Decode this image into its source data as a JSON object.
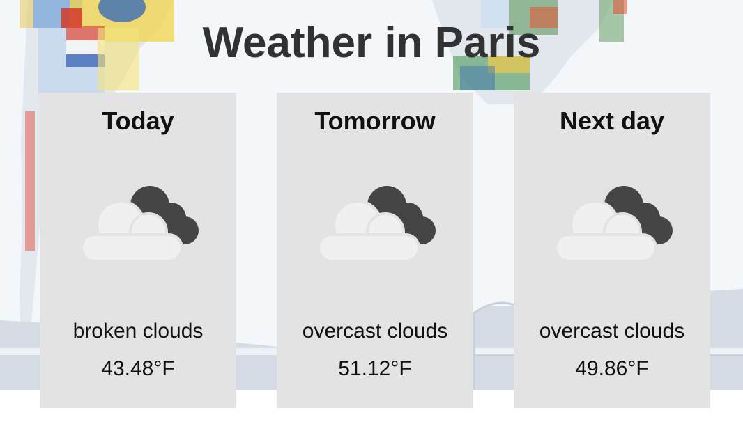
{
  "title": "Weather in Paris",
  "days": [
    {
      "label": "Today",
      "icon": "broken-clouds-icon",
      "description": "broken clouds",
      "temperature": "43.48°F"
    },
    {
      "label": "Tomorrow",
      "icon": "broken-clouds-icon",
      "description": "overcast clouds",
      "temperature": "51.12°F"
    },
    {
      "label": "Next day",
      "icon": "broken-clouds-icon",
      "description": "overcast clouds",
      "temperature": "49.86°F"
    }
  ],
  "colors": {
    "card": "#e3e3e3",
    "title": "#323232",
    "cloud_light": "#f0f0f0",
    "cloud_dark": "#454545"
  }
}
